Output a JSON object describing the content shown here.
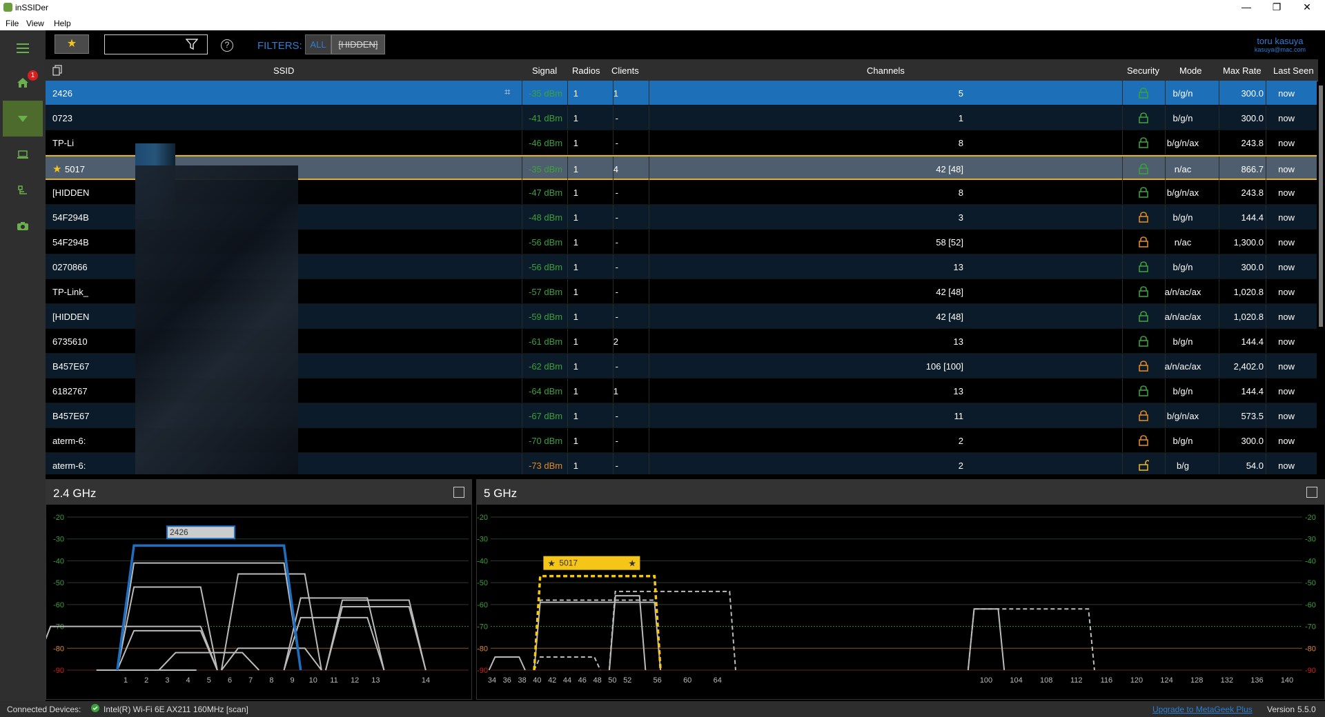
{
  "window": {
    "title": "inSSIDer",
    "minimize": "—",
    "maximize": "❐",
    "close": "✕"
  },
  "menu": [
    "File",
    "View",
    "Help"
  ],
  "nav": {
    "badge": "1",
    "items": [
      "menu-icon",
      "home-icon",
      "networks-icon",
      "laptop-icon",
      "hierarchy-icon",
      "camera-icon"
    ]
  },
  "toolbar": {
    "search_placeholder": "",
    "filters_label": "FILTERS:",
    "filter_all": "ALL",
    "filter_hidden": "[HIDDEN]",
    "help": "?"
  },
  "user": {
    "name": "toru kasuya",
    "email": "kasuya@mac.com"
  },
  "grid": {
    "headers": {
      "ssid": "SSID",
      "signal": "Signal",
      "radios": "Radios",
      "clients": "Clients",
      "channels": "Channels",
      "security": "Security",
      "mode": "Mode",
      "maxrate": "Max Rate",
      "lastseen": "Last Seen"
    },
    "rows": [
      {
        "ssid": "2426",
        "signal": "-35 dBm",
        "radios": "1",
        "clients": "1",
        "channels": "5",
        "lock": "closed",
        "lockColor": "#3aa13a",
        "mode": "b/g/n",
        "rate": "300.0",
        "seen": "now"
      },
      {
        "ssid": "0723",
        "signal": "-41 dBm",
        "radios": "1",
        "clients": "-",
        "channels": "1",
        "lock": "closed",
        "lockColor": "#3aa13a",
        "mode": "b/g/n",
        "rate": "300.0",
        "seen": "now"
      },
      {
        "ssid": "TP-Li",
        "signal": "-46 dBm",
        "radios": "1",
        "clients": "-",
        "channels": "8",
        "lock": "closed",
        "lockColor": "#3aa13a",
        "mode": "b/g/n/ax",
        "rate": "243.8",
        "seen": "now"
      },
      {
        "ssid": "5017",
        "signal": "-35 dBm",
        "radios": "1",
        "clients": "4",
        "channels": "42 [48]",
        "lock": "closed",
        "lockColor": "#3aa13a",
        "mode": "n/ac",
        "rate": "866.7",
        "seen": "now",
        "fav": true
      },
      {
        "ssid": "[HIDDEN",
        "signal": "-47 dBm",
        "radios": "1",
        "clients": "-",
        "channels": "8",
        "lock": "closed",
        "lockColor": "#3aa13a",
        "mode": "b/g/n/ax",
        "rate": "243.8",
        "seen": "now"
      },
      {
        "ssid": "54F294B",
        "signal": "-48 dBm",
        "radios": "1",
        "clients": "-",
        "channels": "3",
        "lock": "closed",
        "lockColor": "#e08a1e",
        "mode": "b/g/n",
        "rate": "144.4",
        "seen": "now"
      },
      {
        "ssid": "54F294B",
        "signal": "-56 dBm",
        "radios": "1",
        "clients": "-",
        "channels": "58 [52]",
        "lock": "closed",
        "lockColor": "#e08a1e",
        "mode": "n/ac",
        "rate": "1,300.0",
        "seen": "now"
      },
      {
        "ssid": "0270866",
        "signal": "-56 dBm",
        "radios": "1",
        "clients": "-",
        "channels": "13",
        "lock": "closed",
        "lockColor": "#3aa13a",
        "mode": "b/g/n",
        "rate": "300.0",
        "seen": "now"
      },
      {
        "ssid": "TP-Link_",
        "signal": "-57 dBm",
        "radios": "1",
        "clients": "-",
        "channels": "42 [48]",
        "lock": "closed",
        "lockColor": "#3aa13a",
        "mode": "a/n/ac/ax",
        "rate": "1,020.8",
        "seen": "now"
      },
      {
        "ssid": "[HIDDEN",
        "signal": "-59 dBm",
        "radios": "1",
        "clients": "-",
        "channels": "42 [48]",
        "lock": "closed",
        "lockColor": "#3aa13a",
        "mode": "a/n/ac/ax",
        "rate": "1,020.8",
        "seen": "now"
      },
      {
        "ssid": "6735610",
        "signal": "-61 dBm",
        "radios": "1",
        "clients": "2",
        "channels": "13",
        "lock": "closed",
        "lockColor": "#3aa13a",
        "mode": "b/g/n",
        "rate": "144.4",
        "seen": "now"
      },
      {
        "ssid": "B457E67",
        "signal": "-62 dBm",
        "radios": "1",
        "clients": "-",
        "channels": "106 [100]",
        "lock": "closed",
        "lockColor": "#e08a1e",
        "mode": "a/n/ac/ax",
        "rate": "2,402.0",
        "seen": "now"
      },
      {
        "ssid": "6182767",
        "signal": "-64 dBm",
        "radios": "1",
        "clients": "1",
        "channels": "13",
        "lock": "closed",
        "lockColor": "#3aa13a",
        "mode": "b/g/n",
        "rate": "144.4",
        "seen": "now"
      },
      {
        "ssid": "B457E67",
        "signal": "-67 dBm",
        "radios": "1",
        "clients": "-",
        "channels": "11",
        "lock": "closed",
        "lockColor": "#e08a1e",
        "mode": "b/g/n/ax",
        "rate": "573.5",
        "seen": "now"
      },
      {
        "ssid": "aterm-6:",
        "signal": "-70 dBm",
        "radios": "1",
        "clients": "-",
        "channels": "2",
        "lock": "closed",
        "lockColor": "#e08a1e",
        "mode": "b/g/n",
        "rate": "300.0",
        "seen": "now"
      },
      {
        "ssid": "aterm-6:",
        "signal": "-73 dBm",
        "radios": "1",
        "clients": "-",
        "channels": "2",
        "lock": "open",
        "lockColor": "#e6b422",
        "mode": "b/g",
        "rate": "54.0",
        "seen": "now"
      }
    ]
  },
  "chart_data": [
    {
      "type": "area",
      "title": "2.4 GHz",
      "ylim": [
        -90,
        -20
      ],
      "yticks": [
        "-20",
        "-30",
        "-40",
        "-50",
        "-60",
        "-70",
        "-80",
        "-90"
      ],
      "xticks": [
        "1",
        "2",
        "3",
        "4",
        "5",
        "6",
        "7",
        "8",
        "9",
        "10",
        "11",
        "12",
        "13",
        "14"
      ],
      "networks": [
        {
          "label": "2426",
          "channel": 5,
          "signal": -33,
          "width": 40,
          "color": "#1f6fc0",
          "highlight": true
        },
        {
          "label": "",
          "channel": 5,
          "signal": -41,
          "width": 40,
          "color": "#bbbbbb"
        },
        {
          "label": "",
          "channel": 8,
          "signal": -46,
          "width": 20,
          "color": "#bbbbbb"
        },
        {
          "label": "",
          "channel": 3,
          "signal": -52,
          "width": 20,
          "color": "#bbbbbb"
        },
        {
          "label": "",
          "channel": 11,
          "signal": -57,
          "width": 20,
          "color": "#bbbbbb"
        },
        {
          "label": "",
          "channel": 13,
          "signal": -58,
          "width": 20,
          "color": "#bbbbbb"
        },
        {
          "label": "",
          "channel": 13,
          "signal": -61,
          "width": 20,
          "color": "#bbbbbb"
        },
        {
          "label": "",
          "channel": 11,
          "signal": -66,
          "width": 20,
          "color": "#bbbbbb"
        },
        {
          "label": "",
          "channel": 1,
          "signal": -70,
          "width": 40,
          "color": "#bbbbbb"
        },
        {
          "label": "",
          "channel": 3,
          "signal": -72,
          "width": 20,
          "color": "#bbbbbb"
        },
        {
          "label": "",
          "channel": 8,
          "signal": -80,
          "width": 20,
          "color": "#bbbbbb"
        },
        {
          "label": "",
          "channel": 5,
          "signal": -82,
          "width": 20,
          "color": "#bbbbbb"
        },
        {
          "label": "",
          "channel": 2,
          "signal": -90,
          "width": 20,
          "color": "#bbbbbb"
        }
      ]
    },
    {
      "type": "area",
      "title": "5 GHz",
      "ylim": [
        -90,
        -20
      ],
      "yticks": [
        "-20",
        "-30",
        "-40",
        "-50",
        "-60",
        "-70",
        "-80",
        "-90"
      ],
      "xticks": [
        "34",
        "36",
        "38",
        "40",
        "42",
        "44",
        "46",
        "48",
        "50",
        "52",
        "56",
        "60",
        "64",
        "100",
        "104",
        "108",
        "112",
        "116",
        "120",
        "124",
        "128",
        "132",
        "136",
        "140"
      ],
      "networks": [
        {
          "label": "5017",
          "channel": 48,
          "signal": -47,
          "width": 80,
          "color": "#f5c518",
          "highlight": true,
          "dashed": true
        },
        {
          "label": "",
          "channel": 48,
          "signal": -58,
          "width": 80,
          "color": "#bbbbbb",
          "dashed": true
        },
        {
          "label": "",
          "channel": 48,
          "signal": -59,
          "width": 80,
          "color": "#bbbbbb"
        },
        {
          "label": "",
          "channel": 52,
          "signal": -56,
          "width": 20,
          "color": "#bbbbbb"
        },
        {
          "label": "",
          "channel": 58,
          "signal": -54,
          "width": 80,
          "color": "#bbbbbb",
          "dashed": true
        },
        {
          "label": "",
          "channel": 106,
          "signal": -62,
          "width": 80,
          "color": "#bbbbbb",
          "dashed": true
        },
        {
          "label": "",
          "channel": 100,
          "signal": -62,
          "width": 20,
          "color": "#bbbbbb"
        },
        {
          "label": "",
          "channel": 36,
          "signal": -84,
          "width": 20,
          "color": "#bbbbbb"
        },
        {
          "label": "",
          "channel": 44,
          "signal": -84,
          "width": 40,
          "color": "#bbbbbb",
          "dashed": true
        }
      ]
    }
  ],
  "status": {
    "connected": "Connected Devices:",
    "device": "Intel(R) Wi-Fi 6E AX211 160MHz [scan]",
    "upgrade": "Upgrade to MetaGeek Plus",
    "version": "Version",
    "version_num": "5.5.0"
  }
}
